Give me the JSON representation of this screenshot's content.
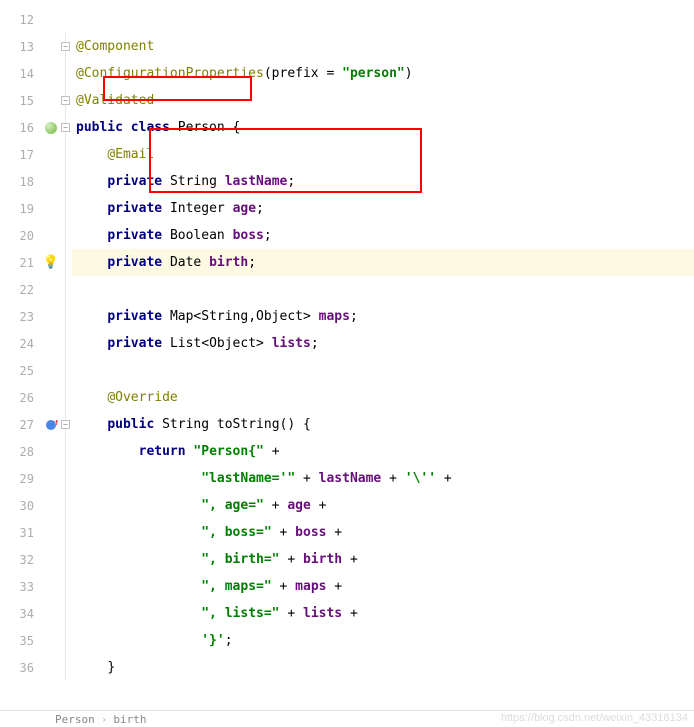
{
  "lines": [
    {
      "n": "12",
      "tokens": []
    },
    {
      "n": "13",
      "tokens": [
        {
          "t": "@Component",
          "c": "ann"
        }
      ],
      "foldIcon": true
    },
    {
      "n": "14",
      "tokens": [
        {
          "t": "@ConfigurationProperties",
          "c": "ann"
        },
        {
          "t": "(prefix = ",
          "c": "pun"
        },
        {
          "t": "\"person\"",
          "c": "str"
        },
        {
          "t": ")",
          "c": "pun"
        }
      ]
    },
    {
      "n": "15",
      "tokens": [
        {
          "t": "@Validated",
          "c": "ann"
        }
      ],
      "foldIconMid": true
    },
    {
      "n": "16",
      "icon": "class",
      "tokens": [
        {
          "t": "public class ",
          "c": "kw"
        },
        {
          "t": "Person {",
          "c": "typ"
        }
      ],
      "foldIcon": true
    },
    {
      "n": "17",
      "indent": 1,
      "tokens": [
        {
          "t": "@Email",
          "c": "ann"
        }
      ]
    },
    {
      "n": "18",
      "indent": 1,
      "tokens": [
        {
          "t": "private ",
          "c": "kw"
        },
        {
          "t": "String ",
          "c": "typ"
        },
        {
          "t": "lastName",
          "c": "fld"
        },
        {
          "t": ";",
          "c": "pun"
        }
      ]
    },
    {
      "n": "19",
      "indent": 1,
      "tokens": [
        {
          "t": "private ",
          "c": "kw"
        },
        {
          "t": "Integer ",
          "c": "typ"
        },
        {
          "t": "age",
          "c": "fld"
        },
        {
          "t": ";",
          "c": "pun"
        }
      ]
    },
    {
      "n": "20",
      "indent": 1,
      "tokens": [
        {
          "t": "private ",
          "c": "kw"
        },
        {
          "t": "Boolean ",
          "c": "typ"
        },
        {
          "t": "boss",
          "c": "fld"
        },
        {
          "t": ";",
          "c": "pun"
        }
      ]
    },
    {
      "n": "21",
      "icon": "bulb",
      "hl": true,
      "indent": 1,
      "tokens": [
        {
          "t": "private ",
          "c": "kw"
        },
        {
          "t": "Date ",
          "c": "typ"
        },
        {
          "t": "birth",
          "c": "fld"
        },
        {
          "t": ";",
          "c": "pun"
        }
      ]
    },
    {
      "n": "22",
      "tokens": []
    },
    {
      "n": "23",
      "indent": 1,
      "tokens": [
        {
          "t": "private ",
          "c": "kw"
        },
        {
          "t": "Map<String,Object> ",
          "c": "typ"
        },
        {
          "t": "maps",
          "c": "fld"
        },
        {
          "t": ";",
          "c": "pun"
        }
      ]
    },
    {
      "n": "24",
      "indent": 1,
      "tokens": [
        {
          "t": "private ",
          "c": "kw"
        },
        {
          "t": "List<Object> ",
          "c": "typ"
        },
        {
          "t": "lists",
          "c": "fld"
        },
        {
          "t": ";",
          "c": "pun"
        }
      ]
    },
    {
      "n": "25",
      "tokens": []
    },
    {
      "n": "26",
      "indent": 1,
      "tokens": [
        {
          "t": "@Override",
          "c": "ann"
        }
      ]
    },
    {
      "n": "27",
      "icon": "override",
      "indent": 1,
      "foldIcon": true,
      "tokens": [
        {
          "t": "public ",
          "c": "kw"
        },
        {
          "t": "String ",
          "c": "typ"
        },
        {
          "t": "toString",
          "c": "mth"
        },
        {
          "t": "() {",
          "c": "pun"
        }
      ]
    },
    {
      "n": "28",
      "indent": 2,
      "tokens": [
        {
          "t": "return ",
          "c": "kw"
        },
        {
          "t": "\"Person{\"",
          "c": "str"
        },
        {
          "t": " +",
          "c": "pun"
        }
      ]
    },
    {
      "n": "29",
      "indent": 4,
      "tokens": [
        {
          "t": "\"lastName='\"",
          "c": "str"
        },
        {
          "t": " + ",
          "c": "pun"
        },
        {
          "t": "lastName",
          "c": "fld"
        },
        {
          "t": " + ",
          "c": "pun"
        },
        {
          "t": "'\\''",
          "c": "chr"
        },
        {
          "t": " +",
          "c": "pun"
        }
      ]
    },
    {
      "n": "30",
      "indent": 4,
      "tokens": [
        {
          "t": "\", age=\"",
          "c": "str"
        },
        {
          "t": " + ",
          "c": "pun"
        },
        {
          "t": "age",
          "c": "fld"
        },
        {
          "t": " +",
          "c": "pun"
        }
      ]
    },
    {
      "n": "31",
      "indent": 4,
      "tokens": [
        {
          "t": "\", boss=\"",
          "c": "str"
        },
        {
          "t": " + ",
          "c": "pun"
        },
        {
          "t": "boss",
          "c": "fld"
        },
        {
          "t": " +",
          "c": "pun"
        }
      ]
    },
    {
      "n": "32",
      "indent": 4,
      "tokens": [
        {
          "t": "\", birth=\"",
          "c": "str"
        },
        {
          "t": " + ",
          "c": "pun"
        },
        {
          "t": "birth",
          "c": "fld"
        },
        {
          "t": " +",
          "c": "pun"
        }
      ]
    },
    {
      "n": "33",
      "indent": 4,
      "tokens": [
        {
          "t": "\", maps=\"",
          "c": "str"
        },
        {
          "t": " + ",
          "c": "pun"
        },
        {
          "t": "maps",
          "c": "fld"
        },
        {
          "t": " +",
          "c": "pun"
        }
      ]
    },
    {
      "n": "34",
      "indent": 4,
      "tokens": [
        {
          "t": "\", lists=\"",
          "c": "str"
        },
        {
          "t": " + ",
          "c": "pun"
        },
        {
          "t": "lists",
          "c": "fld"
        },
        {
          "t": " +",
          "c": "pun"
        }
      ]
    },
    {
      "n": "35",
      "indent": 4,
      "tokens": [
        {
          "t": "'}'",
          "c": "chr"
        },
        {
          "t": ";",
          "c": "pun"
        }
      ]
    },
    {
      "n": "36",
      "indent": 1,
      "tokens": [
        {
          "t": "}",
          "c": "pun"
        }
      ]
    }
  ],
  "breadcrumb": {
    "cls": "Person",
    "fld": "birth"
  },
  "watermark": "https://blog.csdn.net/weixin_43318134",
  "foldMinus": "−"
}
